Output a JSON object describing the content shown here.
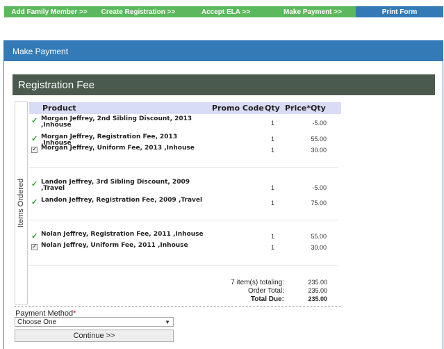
{
  "steps": [
    {
      "label": "Add Family Member >>"
    },
    {
      "label": "Create Registration >>"
    },
    {
      "label": "Accept ELA >>"
    },
    {
      "label": "Make Payment >>"
    },
    {
      "label": "Print Form"
    }
  ],
  "panel": {
    "title": "Make Payment"
  },
  "section": {
    "title": "Registration Fee",
    "items_legend": "Items Ordered"
  },
  "table": {
    "headers": {
      "product": "Product",
      "promo": "Promo Code",
      "qty": "Qty",
      "price": "Price*Qty"
    },
    "rows": [
      {
        "mark": "check-icon",
        "name": "Morgan Jeffrey, 2nd Sibling Discount, 2013 ,Inhouse",
        "qty": "1",
        "price": "-5.00"
      },
      {
        "mark": "check-icon",
        "name": "Morgan Jeffrey, Registration Fee, 2013 ,Inhouse",
        "qty": "1",
        "price": "55.00"
      },
      {
        "mark": "checkbox-icon",
        "name": "Morgan Jeffrey, Uniform Fee, 2013 ,Inhouse",
        "qty": "1",
        "price": "30.00"
      },
      {
        "mark": "check-icon",
        "name": "Landon Jeffrey, 3rd Sibling Discount, 2009 ,Travel",
        "qty": "1",
        "price": "-5.00"
      },
      {
        "mark": "check-icon",
        "name": "Landon Jeffrey, Registration Fee, 2009 ,Travel",
        "qty": "1",
        "price": "75.00"
      },
      {
        "mark": "check-icon",
        "name": "Nolan Jeffrey, Registration Fee, 2011 ,Inhouse",
        "qty": "1",
        "price": "55.00"
      },
      {
        "mark": "checkbox-icon",
        "name": "Nolan Jeffrey, Uniform Fee, 2011 ,Inhouse",
        "qty": "1",
        "price": "30.00"
      }
    ]
  },
  "totals": {
    "items_label": "7 item(s) totaling:",
    "items_value": "235.00",
    "order_label": "Order Total:",
    "order_value": "235.00",
    "due_label": "Total Due:",
    "due_value": "235.00"
  },
  "payment": {
    "label": "Payment Method",
    "required_mark": "*",
    "selected": "Choose One",
    "continue_label": "Continue >>"
  },
  "colors": {
    "step_done": "#5cb85c",
    "step_active": "#337ab7",
    "banner": "#4a5a4e",
    "header_row": "#d9dcf5"
  }
}
